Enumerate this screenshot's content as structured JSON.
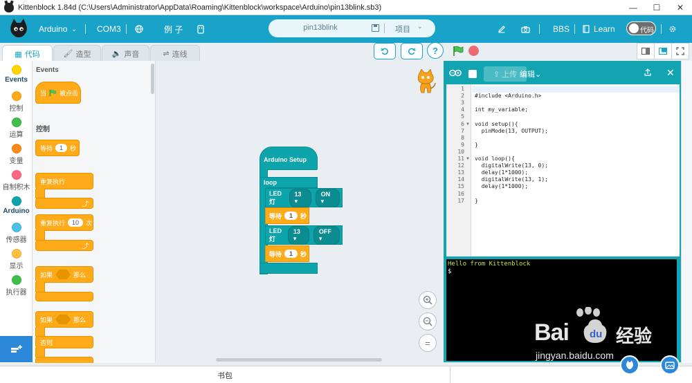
{
  "window": {
    "title": "Kittenblock 1.84d (C:\\Users\\Administrator\\AppData\\Roaming\\Kittenblock\\workspace\\Arduino\\pin13blink.sb3)",
    "minimize": "—",
    "maximize": "☐",
    "close": "✕"
  },
  "menubar": {
    "board": "Arduino",
    "port": "COM3",
    "examples": "例 子",
    "project_name": "pin13blink",
    "project_menu": "项目",
    "bbs": "BBS",
    "learn": "Learn",
    "code_toggle": "代码"
  },
  "tabs": [
    {
      "label": "代码"
    },
    {
      "label": "造型"
    },
    {
      "label": "声音"
    },
    {
      "label": "连线"
    }
  ],
  "categories": [
    {
      "label": "Events",
      "color": "#ffd500"
    },
    {
      "label": "控制",
      "color": "#ffab19"
    },
    {
      "label": "运算",
      "color": "#40bf4a"
    },
    {
      "label": "变量",
      "color": "#ff8c1a"
    },
    {
      "label": "自制积木",
      "color": "#ff6680"
    },
    {
      "label": "Arduino",
      "color": "#0da5ab"
    },
    {
      "label": "传感器",
      "color": "#4cbfe6"
    },
    {
      "label": "显示",
      "color": "#ffbf40"
    },
    {
      "label": "执行器",
      "color": "#40bf4a"
    }
  ],
  "palette": {
    "events_heading": "Events",
    "when_clicked_prefix": "当",
    "when_clicked_suffix": "被点击",
    "control_heading": "控制",
    "wait_label": "等待",
    "wait_value": "1",
    "wait_unit": "秒",
    "forever_label": "重复执行",
    "repeat_label": "重复执行",
    "repeat_value": "10",
    "repeat_unit": "次",
    "if_label": "如果",
    "then_label": "那么",
    "else_label": "否则"
  },
  "workspace": {
    "setup_label": "Arduino Setup",
    "loop_label": "loop",
    "led_label": "LED灯",
    "pin": "13",
    "on": "ON",
    "off": "OFF",
    "wait_label": "等待",
    "wait_value": "1",
    "wait_unit": "秒",
    "zoom_in": "+",
    "zoom_out": "−",
    "zoom_reset": "="
  },
  "code_panel": {
    "download_label": "上传",
    "edit_label": "编辑",
    "lines": [
      "",
      "#include <Arduino.h>",
      "",
      "int my_variable;",
      "",
      "void setup(){",
      "  pinMode(13, OUTPUT);",
      "",
      "}",
      "",
      "void loop(){",
      "  digitalWrite(13, 0);",
      "  delay(1*1000);",
      "  digitalWrite(13, 1);",
      "  delay(1*1000);",
      "",
      "}"
    ],
    "line_numbers": [
      "1",
      "2",
      "3",
      "4",
      "5",
      "6",
      "7",
      "8",
      "9",
      "10",
      "11",
      "12",
      "13",
      "14",
      "15",
      "16",
      "17"
    ],
    "terminal_lines": [
      "Hello from Kittenblock",
      "$"
    ]
  },
  "bottom": {
    "bag": "书包"
  },
  "watermark": {
    "brand": "Bai",
    "brand_cn": "经验",
    "url": "jingyan.baidu.com"
  },
  "colors": {
    "accent": "#1aa3c8",
    "arduino_block": "#0da5ab",
    "control_block": "#ffab19",
    "terminal_text": "#c8e33a"
  }
}
